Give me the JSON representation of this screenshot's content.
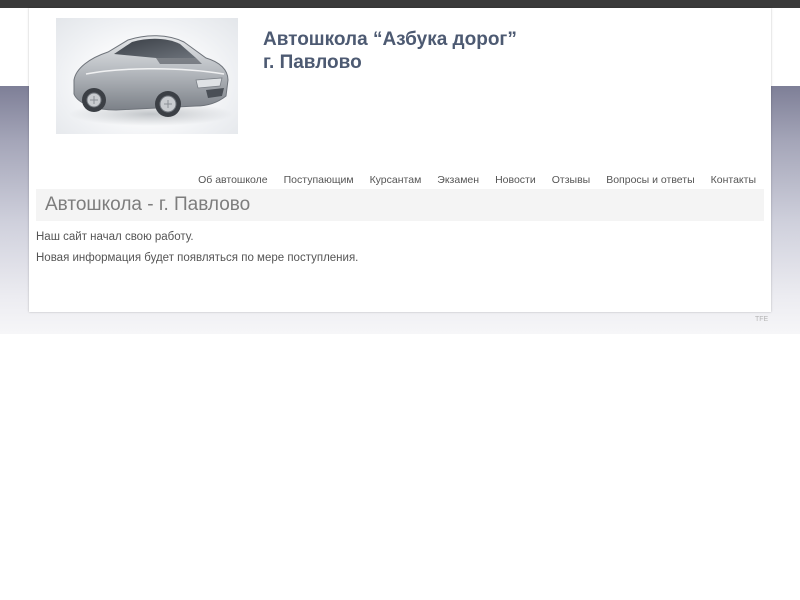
{
  "header": {
    "title_line1": "Автошкола “Азбука дорог”",
    "title_line2": "г. Павлово",
    "logo_icon": "car-icon"
  },
  "nav": {
    "items": [
      {
        "label": "Об автошколе"
      },
      {
        "label": "Поступающим"
      },
      {
        "label": "Курсантам"
      },
      {
        "label": "Экзамен"
      },
      {
        "label": "Новости"
      },
      {
        "label": "Отзывы"
      },
      {
        "label": "Вопросы и ответы"
      },
      {
        "label": "Контакты"
      }
    ]
  },
  "content": {
    "heading": "Автошкола - г. Павлово",
    "paragraphs": [
      "Наш сайт начал свою работу.",
      "Новая информация будет появляться по мере поступления."
    ]
  },
  "footer": {
    "mark": "TFE"
  },
  "colors": {
    "title": "#4d5a72",
    "top_bar": "#3a3a3a",
    "band_top": "#7e7f97",
    "text": "#555555"
  }
}
